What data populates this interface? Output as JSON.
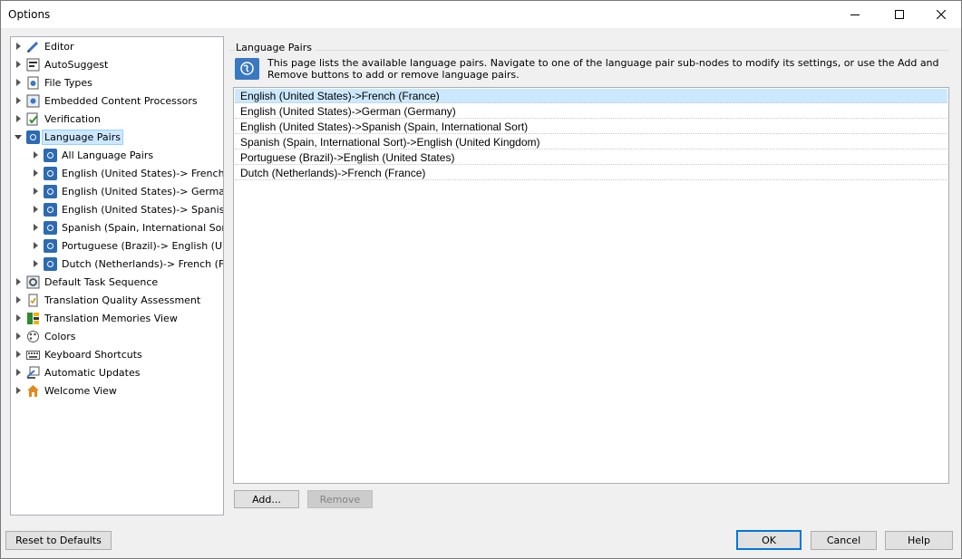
{
  "window": {
    "title": "Options"
  },
  "tree": {
    "items": [
      {
        "label": "Editor",
        "icon": "pencil-icon",
        "expanded": false
      },
      {
        "label": "AutoSuggest",
        "icon": "autosuggest-icon",
        "expanded": false
      },
      {
        "label": "File Types",
        "icon": "file-types-icon",
        "expanded": false
      },
      {
        "label": "Embedded Content Processors",
        "icon": "processor-icon",
        "expanded": false
      },
      {
        "label": "Verification",
        "icon": "verification-icon",
        "expanded": false
      },
      {
        "label": "Language Pairs",
        "icon": "language-pair-icon",
        "expanded": true,
        "selected": true
      },
      {
        "label": "Default Task Sequence",
        "icon": "task-sequence-icon",
        "expanded": false
      },
      {
        "label": "Translation Quality Assessment",
        "icon": "quality-assessment-icon",
        "expanded": false
      },
      {
        "label": "Translation Memories View",
        "icon": "translation-memories-icon",
        "expanded": false
      },
      {
        "label": "Colors",
        "icon": "palette-icon",
        "expanded": false
      },
      {
        "label": "Keyboard Shortcuts",
        "icon": "keyboard-icon",
        "expanded": false
      },
      {
        "label": "Automatic Updates",
        "icon": "updates-icon",
        "expanded": false
      },
      {
        "label": "Welcome View",
        "icon": "home-icon",
        "expanded": false
      }
    ],
    "language_pair_children": [
      "All Language Pairs",
      "English (United States)-> French (F",
      "English (United States)-> German (",
      "English (United States)-> Spanish (",
      "Spanish (Spain, International Sort)",
      "Portuguese (Brazil)-> English (Unit",
      "Dutch (Netherlands)-> French (Fra"
    ]
  },
  "panel": {
    "group_title": "Language Pairs",
    "info_icon": "globe-icon",
    "info_text": "This page lists the available language pairs. Navigate to one of the language pair sub-nodes to modify its settings, or use the Add and Remove buttons to add or remove language pairs.",
    "pairs": [
      "English (United States)->French (France)",
      "English (United States)->German (Germany)",
      "English (United States)->Spanish (Spain, International Sort)",
      "Spanish (Spain, International Sort)->English (United Kingdom)",
      "Portuguese (Brazil)->English (United States)",
      "Dutch (Netherlands)->French (France)"
    ],
    "selected_pair_index": 0,
    "add_label": "Add...",
    "remove_label": "Remove"
  },
  "footer": {
    "reset_label": "Reset to Defaults",
    "ok_label": "OK",
    "cancel_label": "Cancel",
    "help_label": "Help"
  },
  "colors": {
    "accent": "#0078d7",
    "selection": "#cce8ff",
    "language_pair_icon": "#2d6ab4"
  }
}
